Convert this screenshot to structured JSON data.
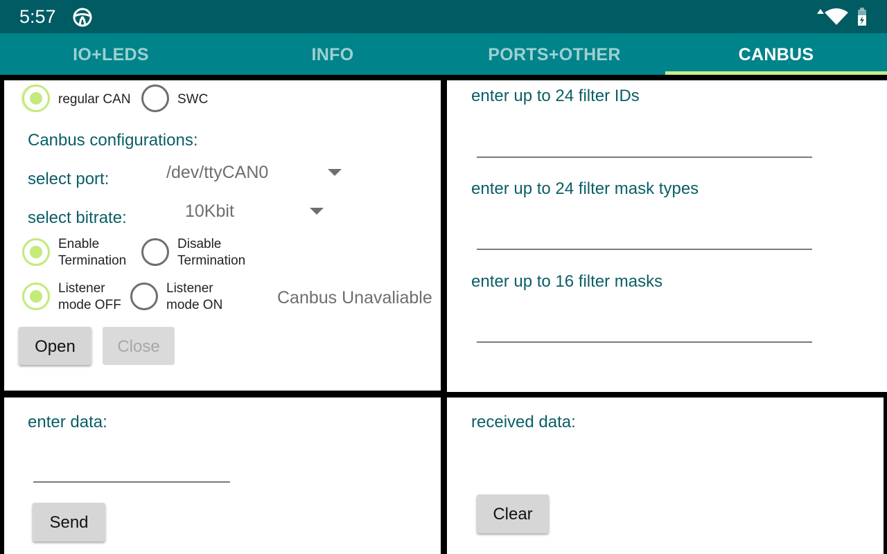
{
  "status": {
    "time": "5:57"
  },
  "tabs": [
    {
      "label": "IO+LEDS"
    },
    {
      "label": "INFO"
    },
    {
      "label": "PORTS+OTHER"
    },
    {
      "label": "CANBUS"
    }
  ],
  "config": {
    "can_type": {
      "regular": "regular CAN",
      "swc": "SWC",
      "selected": "regular CAN"
    },
    "heading": "Canbus configurations:",
    "port_label": "select port:",
    "port_value": "/dev/ttyCAN0",
    "bitrate_label": "select bitrate:",
    "bitrate_value": "10Kbit",
    "termination": {
      "enable_line1": "Enable",
      "enable_line2": "Termination",
      "disable_line1": "Disable",
      "disable_line2": "Termination",
      "selected": "Enable"
    },
    "listener": {
      "off_line1": "Listener",
      "off_line2": "mode OFF",
      "on_line1": "Listener",
      "on_line2": "mode ON",
      "selected": "OFF"
    },
    "status_text": "Canbus Unavaliable",
    "open_label": "Open",
    "close_label": "Close"
  },
  "filters": {
    "ids_label": "enter up to 24 filter IDs",
    "ids_value": "",
    "mask_types_label": "enter up to 24 filter mask types",
    "mask_types_value": "",
    "masks_label": "enter up to 16 filter masks",
    "masks_value": ""
  },
  "send": {
    "label": "enter data:",
    "value": "",
    "button": "Send"
  },
  "receive": {
    "label": "received data:",
    "button": "Clear"
  },
  "colors": {
    "statusbar": "#005B63",
    "tabbar": "#00838A",
    "accent": "#C3EA7A",
    "label": "#0B5E66"
  }
}
